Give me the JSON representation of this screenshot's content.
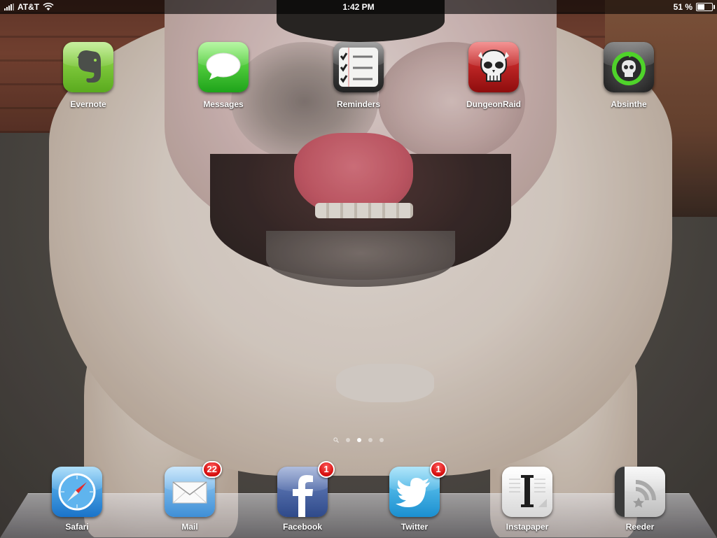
{
  "status_bar": {
    "carrier": "AT&T",
    "time": "1:42 PM",
    "battery_percent": "51 %",
    "battery_level": 0.51
  },
  "home_apps": [
    {
      "id": "evernote",
      "label": "Evernote",
      "icon": "evernote-elephant-icon",
      "color": "#6fbf2d"
    },
    {
      "id": "messages",
      "label": "Messages",
      "icon": "speech-bubble-icon",
      "color": "#3dbb22"
    },
    {
      "id": "reminders",
      "label": "Reminders",
      "icon": "checklist-icon",
      "color": "#3a3a3a"
    },
    {
      "id": "dungeonraid",
      "label": "DungeonRaid",
      "icon": "skull-icon",
      "color": "#c4161c"
    },
    {
      "id": "absinthe",
      "label": "Absinthe",
      "icon": "apple-skull-icon",
      "color": "#3c3c3c"
    }
  ],
  "page_indicator": {
    "pages": 4,
    "active_index": 1,
    "has_search": true
  },
  "dock_apps": [
    {
      "id": "safari",
      "label": "Safari",
      "icon": "compass-icon",
      "badge": "",
      "color": "#2c8bd6"
    },
    {
      "id": "mail",
      "label": "Mail",
      "icon": "envelope-icon",
      "badge": "22",
      "color": "#5aa7e6"
    },
    {
      "id": "facebook",
      "label": "Facebook",
      "icon": "facebook-f-icon",
      "badge": "1",
      "color": "#3b5998"
    },
    {
      "id": "twitter",
      "label": "Twitter",
      "icon": "twitter-bird-icon",
      "badge": "1",
      "color": "#2aa9e0"
    },
    {
      "id": "instapaper",
      "label": "Instapaper",
      "icon": "instapaper-i-icon",
      "badge": "",
      "color": "#f2f2f2"
    },
    {
      "id": "reeder",
      "label": "Reeder",
      "icon": "rss-star-icon",
      "badge": "",
      "color": "#d8d8d8"
    }
  ]
}
